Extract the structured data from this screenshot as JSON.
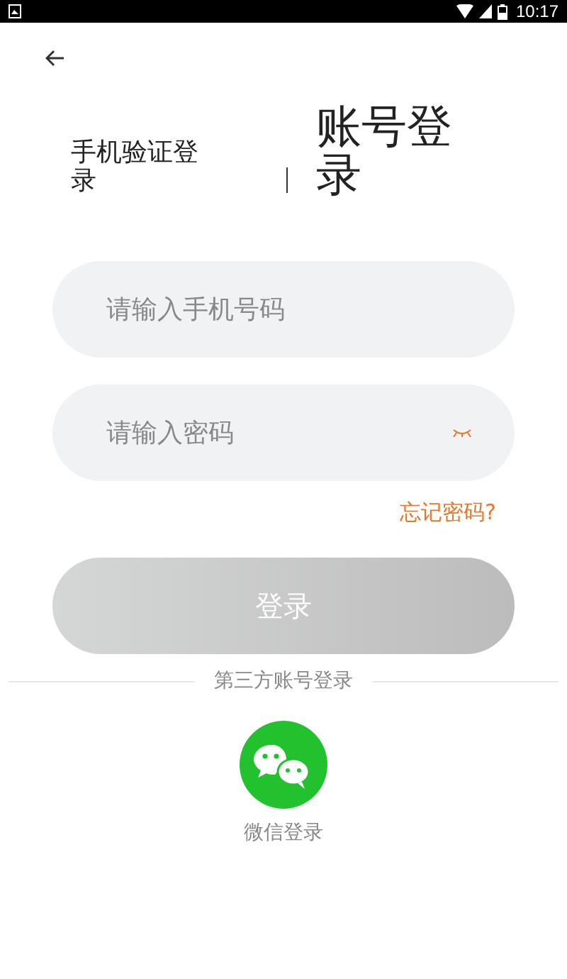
{
  "status_bar": {
    "time": "10:17"
  },
  "tabs": [
    {
      "label": "手机验证登录",
      "selected": false
    },
    {
      "label": "账号登录",
      "selected": true
    }
  ],
  "phone_field": {
    "placeholder": "请输入手机号码"
  },
  "password_field": {
    "placeholder": "请输入密码"
  },
  "forgot_link": "忘记密码?",
  "login_button": {
    "label": "登录",
    "disabled": true
  },
  "third_party": {
    "heading": "第三方账号登录",
    "options": [
      {
        "label": "微信登录"
      }
    ]
  }
}
